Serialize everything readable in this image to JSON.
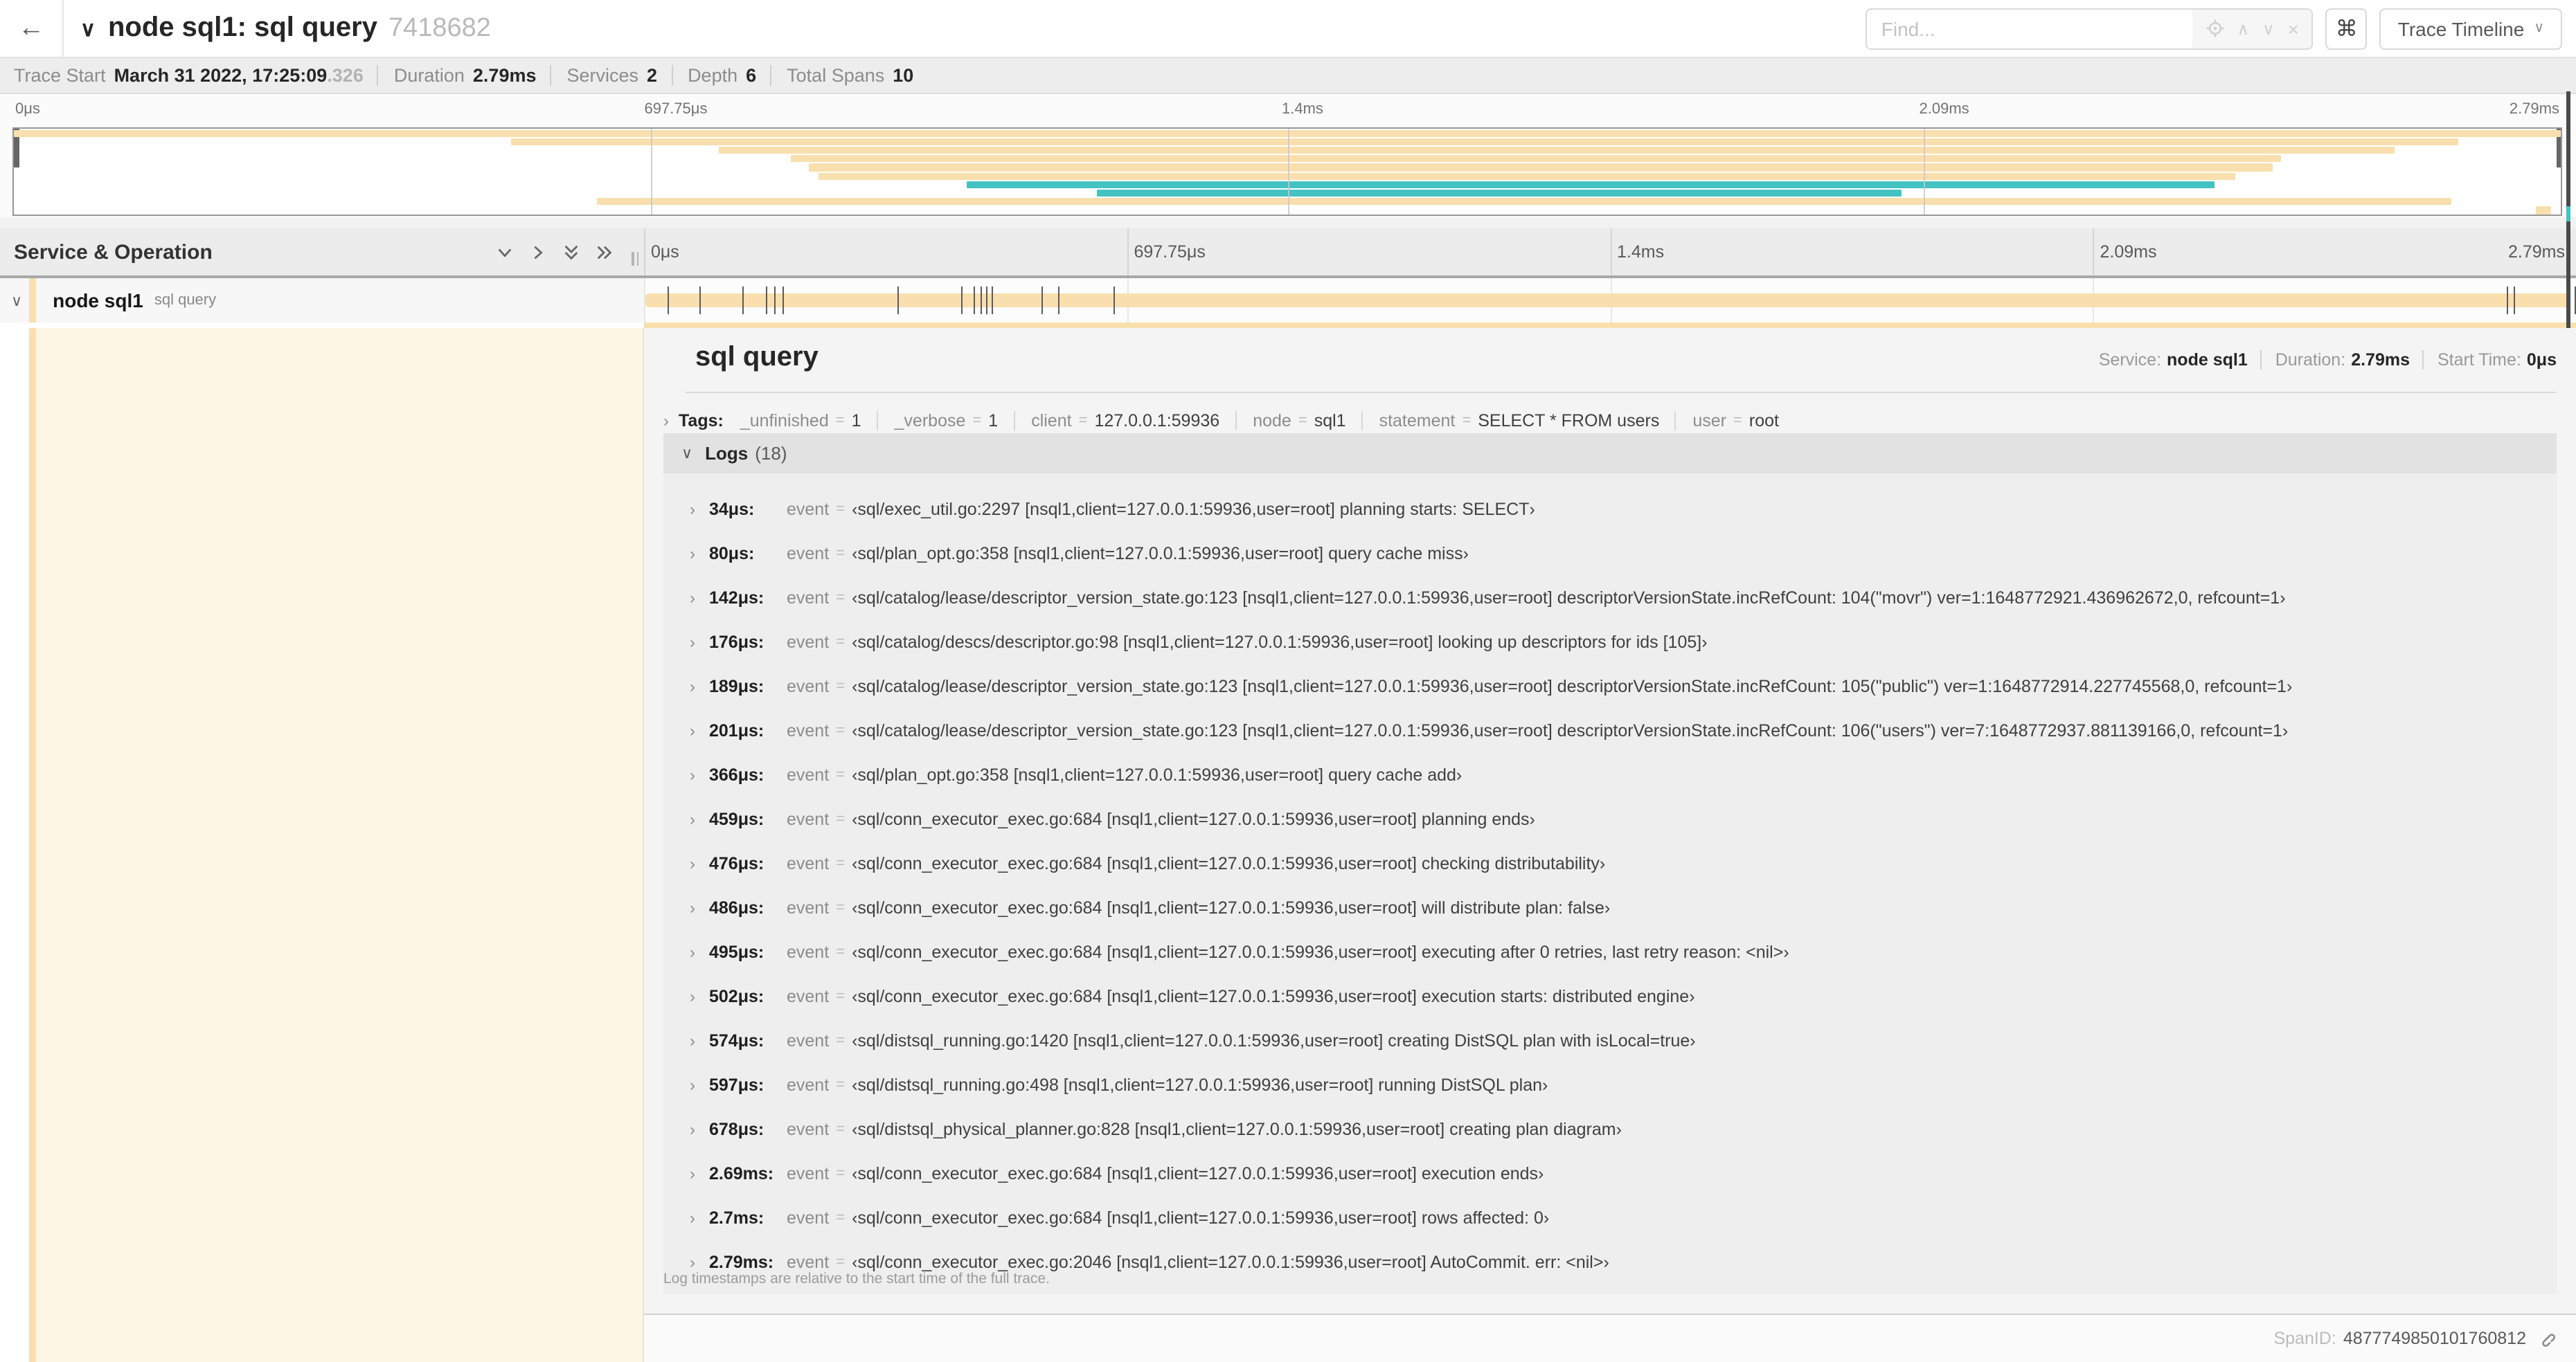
{
  "colors": {
    "tan": "#F8DFAD",
    "teal": "#45C2C2",
    "cream": "#FDF6E5"
  },
  "header": {
    "back_icon": "←",
    "collapse_chevron": "∨",
    "title": "node sql1: sql query",
    "trace_id": "7418682",
    "find_placeholder": "Find...",
    "prev_icon": "∧",
    "next_icon": "∨",
    "clear_icon": "×",
    "shortcut_icon": "⌘",
    "view_selector_label": "Trace Timeline",
    "view_selector_chevron": "∨"
  },
  "trace_meta": {
    "items": [
      {
        "label": "Trace Start",
        "value": "March 31 2022, 17:25:09",
        "muted": ".326"
      },
      {
        "label": "Duration",
        "value": "2.79ms",
        "muted": ""
      },
      {
        "label": "Services",
        "value": "2",
        "muted": ""
      },
      {
        "label": "Depth",
        "value": "6",
        "muted": ""
      },
      {
        "label": "Total Spans",
        "value": "10",
        "muted": ""
      }
    ]
  },
  "minimap": {
    "labels": [
      {
        "label": "0μs",
        "pos": 0
      },
      {
        "label": "697.75μs",
        "pos": 25
      },
      {
        "label": "1.4ms",
        "pos": 50
      },
      {
        "label": "2.09ms",
        "pos": 75
      },
      {
        "label": "2.79ms",
        "pos": 100
      }
    ],
    "rows": [
      {
        "start": 0,
        "end": 100,
        "color": "tan"
      },
      {
        "start": 19.5,
        "end": 96,
        "color": "tan"
      },
      {
        "start": 27.7,
        "end": 93.5,
        "color": "tan"
      },
      {
        "start": 30.5,
        "end": 89,
        "color": "tan"
      },
      {
        "start": 31.2,
        "end": 88.7,
        "color": "tan"
      },
      {
        "start": 31.6,
        "end": 87.2,
        "color": "tan"
      },
      {
        "start": 37.4,
        "end": 86.4,
        "color": "teal"
      },
      {
        "start": 42.5,
        "end": 74.1,
        "color": "teal"
      },
      {
        "start": 22.9,
        "end": 95.7,
        "color": "tan"
      },
      {
        "start": 99.0,
        "end": 99.6,
        "color": "tan"
      }
    ]
  },
  "timeline": {
    "left_header": "Service & Operation",
    "ruler_labels": [
      {
        "label": "0μs",
        "pos": 0
      },
      {
        "label": "697.75μs",
        "pos": 25
      },
      {
        "label": "1.4ms",
        "pos": 50
      },
      {
        "label": "2.09ms",
        "pos": 75
      },
      {
        "label": "2.79ms",
        "pos": 100
      }
    ],
    "span_row": {
      "chevron": "∨",
      "service": "node sql1",
      "operation": "sql query"
    },
    "log_tick_percents": [
      1.22,
      2.87,
      5.09,
      6.31,
      6.77,
      7.2,
      13.12,
      16.45,
      17.06,
      17.42,
      17.74,
      17.99,
      20.57,
      21.4,
      24.3,
      96.42,
      96.77,
      99.9
    ]
  },
  "detail": {
    "title": "sql query",
    "overview": [
      {
        "label": "Service:",
        "value": "node sql1"
      },
      {
        "label": "Duration:",
        "value": "2.79ms"
      },
      {
        "label": "Start Time:",
        "value": "0μs"
      }
    ],
    "tags": {
      "chevron": "›",
      "label": "Tags:",
      "items": [
        {
          "key": "_unfinished",
          "value": "1"
        },
        {
          "key": "_verbose",
          "value": "1"
        },
        {
          "key": "client",
          "value": "127.0.0.1:59936"
        },
        {
          "key": "node",
          "value": "sql1"
        },
        {
          "key": "statement",
          "value": "SELECT * FROM users"
        },
        {
          "key": "user",
          "value": "root"
        }
      ]
    },
    "logs": {
      "chevron": "∨",
      "label": "Logs",
      "count": "(18)",
      "row_chevron": "›",
      "key_label": "event",
      "rows": [
        {
          "time": "34μs:",
          "value": "‹sql/exec_util.go:2297 [nsql1,client=127.0.0.1:59936,user=root] planning starts: SELECT›"
        },
        {
          "time": "80μs:",
          "value": "‹sql/plan_opt.go:358 [nsql1,client=127.0.0.1:59936,user=root] query cache miss›"
        },
        {
          "time": "142μs:",
          "value": "‹sql/catalog/lease/descriptor_version_state.go:123 [nsql1,client=127.0.0.1:59936,user=root] descriptorVersionState.incRefCount: 104(\"movr\") ver=1:1648772921.436962672,0, refcount=1›"
        },
        {
          "time": "176μs:",
          "value": "‹sql/catalog/descs/descriptor.go:98 [nsql1,client=127.0.0.1:59936,user=root] looking up descriptors for ids [105]›"
        },
        {
          "time": "189μs:",
          "value": "‹sql/catalog/lease/descriptor_version_state.go:123 [nsql1,client=127.0.0.1:59936,user=root] descriptorVersionState.incRefCount: 105(\"public\") ver=1:1648772914.227745568,0, refcount=1›"
        },
        {
          "time": "201μs:",
          "value": "‹sql/catalog/lease/descriptor_version_state.go:123 [nsql1,client=127.0.0.1:59936,user=root] descriptorVersionState.incRefCount: 106(\"users\") ver=7:1648772937.881139166,0, refcount=1›"
        },
        {
          "time": "366μs:",
          "value": "‹sql/plan_opt.go:358 [nsql1,client=127.0.0.1:59936,user=root] query cache add›"
        },
        {
          "time": "459μs:",
          "value": "‹sql/conn_executor_exec.go:684 [nsql1,client=127.0.0.1:59936,user=root] planning ends›"
        },
        {
          "time": "476μs:",
          "value": "‹sql/conn_executor_exec.go:684 [nsql1,client=127.0.0.1:59936,user=root] checking distributability›"
        },
        {
          "time": "486μs:",
          "value": "‹sql/conn_executor_exec.go:684 [nsql1,client=127.0.0.1:59936,user=root] will distribute plan: false›"
        },
        {
          "time": "495μs:",
          "value": "‹sql/conn_executor_exec.go:684 [nsql1,client=127.0.0.1:59936,user=root] executing after 0 retries, last retry reason: <nil>›"
        },
        {
          "time": "502μs:",
          "value": "‹sql/conn_executor_exec.go:684 [nsql1,client=127.0.0.1:59936,user=root] execution starts: distributed engine›"
        },
        {
          "time": "574μs:",
          "value": "‹sql/distsql_running.go:1420 [nsql1,client=127.0.0.1:59936,user=root] creating DistSQL plan with isLocal=true›"
        },
        {
          "time": "597μs:",
          "value": "‹sql/distsql_running.go:498 [nsql1,client=127.0.0.1:59936,user=root] running DistSQL plan›"
        },
        {
          "time": "678μs:",
          "value": "‹sql/distsql_physical_planner.go:828 [nsql1,client=127.0.0.1:59936,user=root] creating plan diagram›"
        },
        {
          "time": "2.69ms:",
          "value": "‹sql/conn_executor_exec.go:684 [nsql1,client=127.0.0.1:59936,user=root] execution ends›"
        },
        {
          "time": "2.7ms:",
          "value": "‹sql/conn_executor_exec.go:684 [nsql1,client=127.0.0.1:59936,user=root] rows affected: 0›"
        },
        {
          "time": "2.79ms:",
          "value": "‹sql/conn_executor_exec.go:2046 [nsql1,client=127.0.0.1:59936,user=root] AutoCommit. err: <nil>›"
        }
      ],
      "footer": "Log timestamps are relative to the start time of the full trace."
    },
    "span_id_label": "SpanID:",
    "span_id": "4877749850101760812"
  }
}
